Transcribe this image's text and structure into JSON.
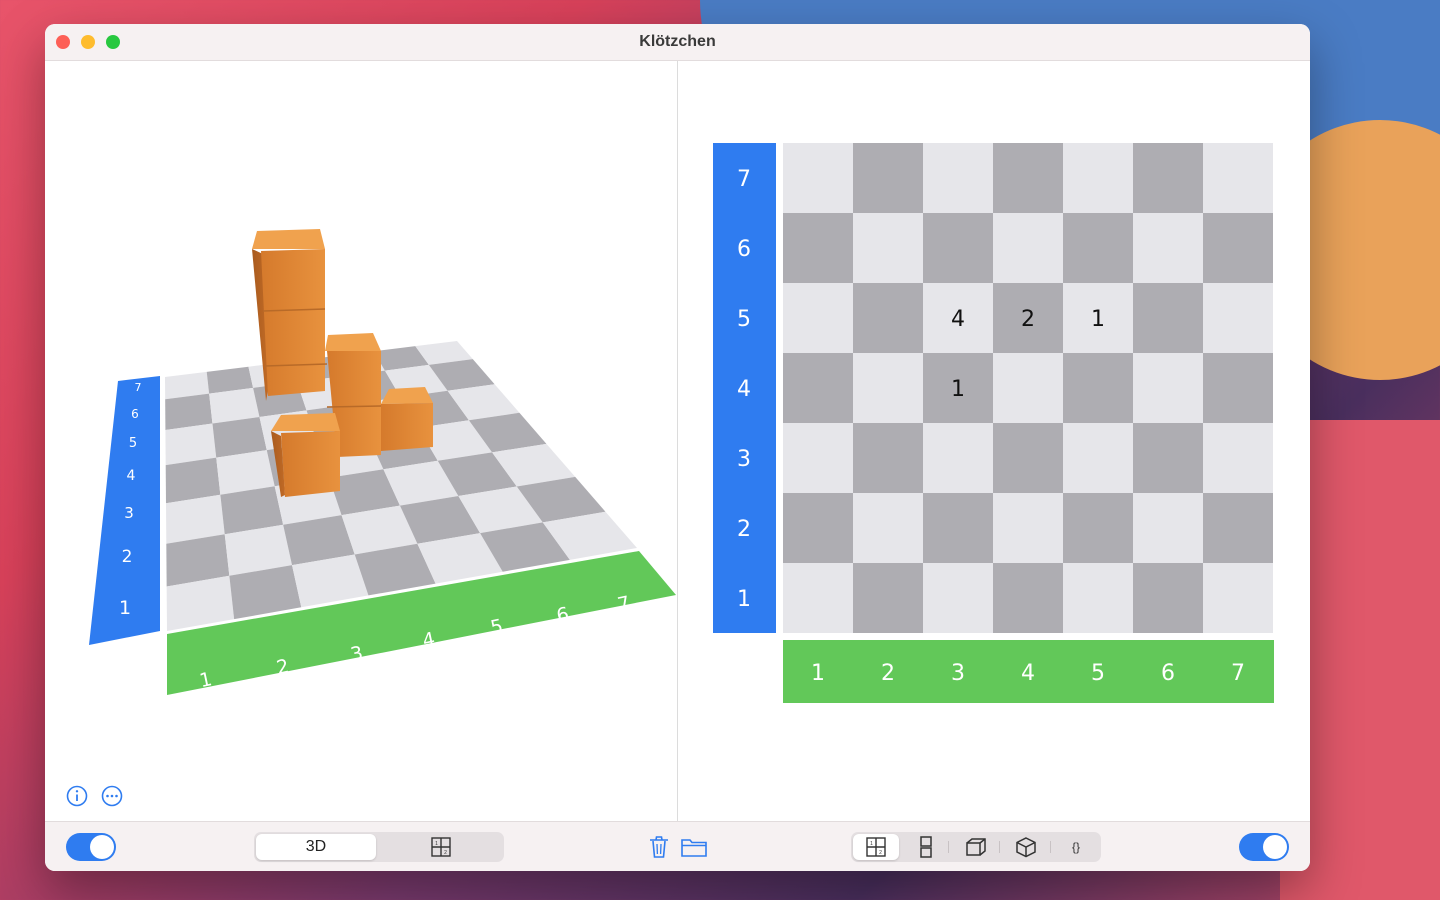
{
  "window": {
    "title": "Klötzchen"
  },
  "grid2d": {
    "rows_labels": [
      "7",
      "6",
      "5",
      "4",
      "3",
      "2",
      "1"
    ],
    "cols_labels": [
      "1",
      "2",
      "3",
      "4",
      "5",
      "6",
      "7"
    ],
    "heights": [
      {
        "col": 3,
        "row": 5,
        "value": "4"
      },
      {
        "col": 4,
        "row": 5,
        "value": "2"
      },
      {
        "col": 5,
        "row": 5,
        "value": "1"
      },
      {
        "col": 3,
        "row": 4,
        "value": "1"
      }
    ],
    "colors": {
      "light": "#e6e6ea",
      "dark": "#aeadb2",
      "row_axis": "#2f7cf0",
      "col_axis": "#62c859"
    }
  },
  "view3d": {
    "row_labels": [
      "7",
      "6",
      "5",
      "4",
      "3",
      "2",
      "1"
    ],
    "col_labels": [
      "1",
      "2",
      "3",
      "4",
      "5",
      "6",
      "7"
    ]
  },
  "bottombar": {
    "view_segment": {
      "options": [
        "3D",
        "grid-view-icon"
      ],
      "selected": "3D"
    },
    "right_segment": {
      "options": [
        "top-view-icon",
        "front-view-icon",
        "side-view-icon",
        "iso-cube-icon",
        "code-braces-icon"
      ],
      "selected": 0
    },
    "code_label": "{}"
  },
  "colors": {
    "accent": "#2f7cf0",
    "wood": "#e58e3a"
  }
}
